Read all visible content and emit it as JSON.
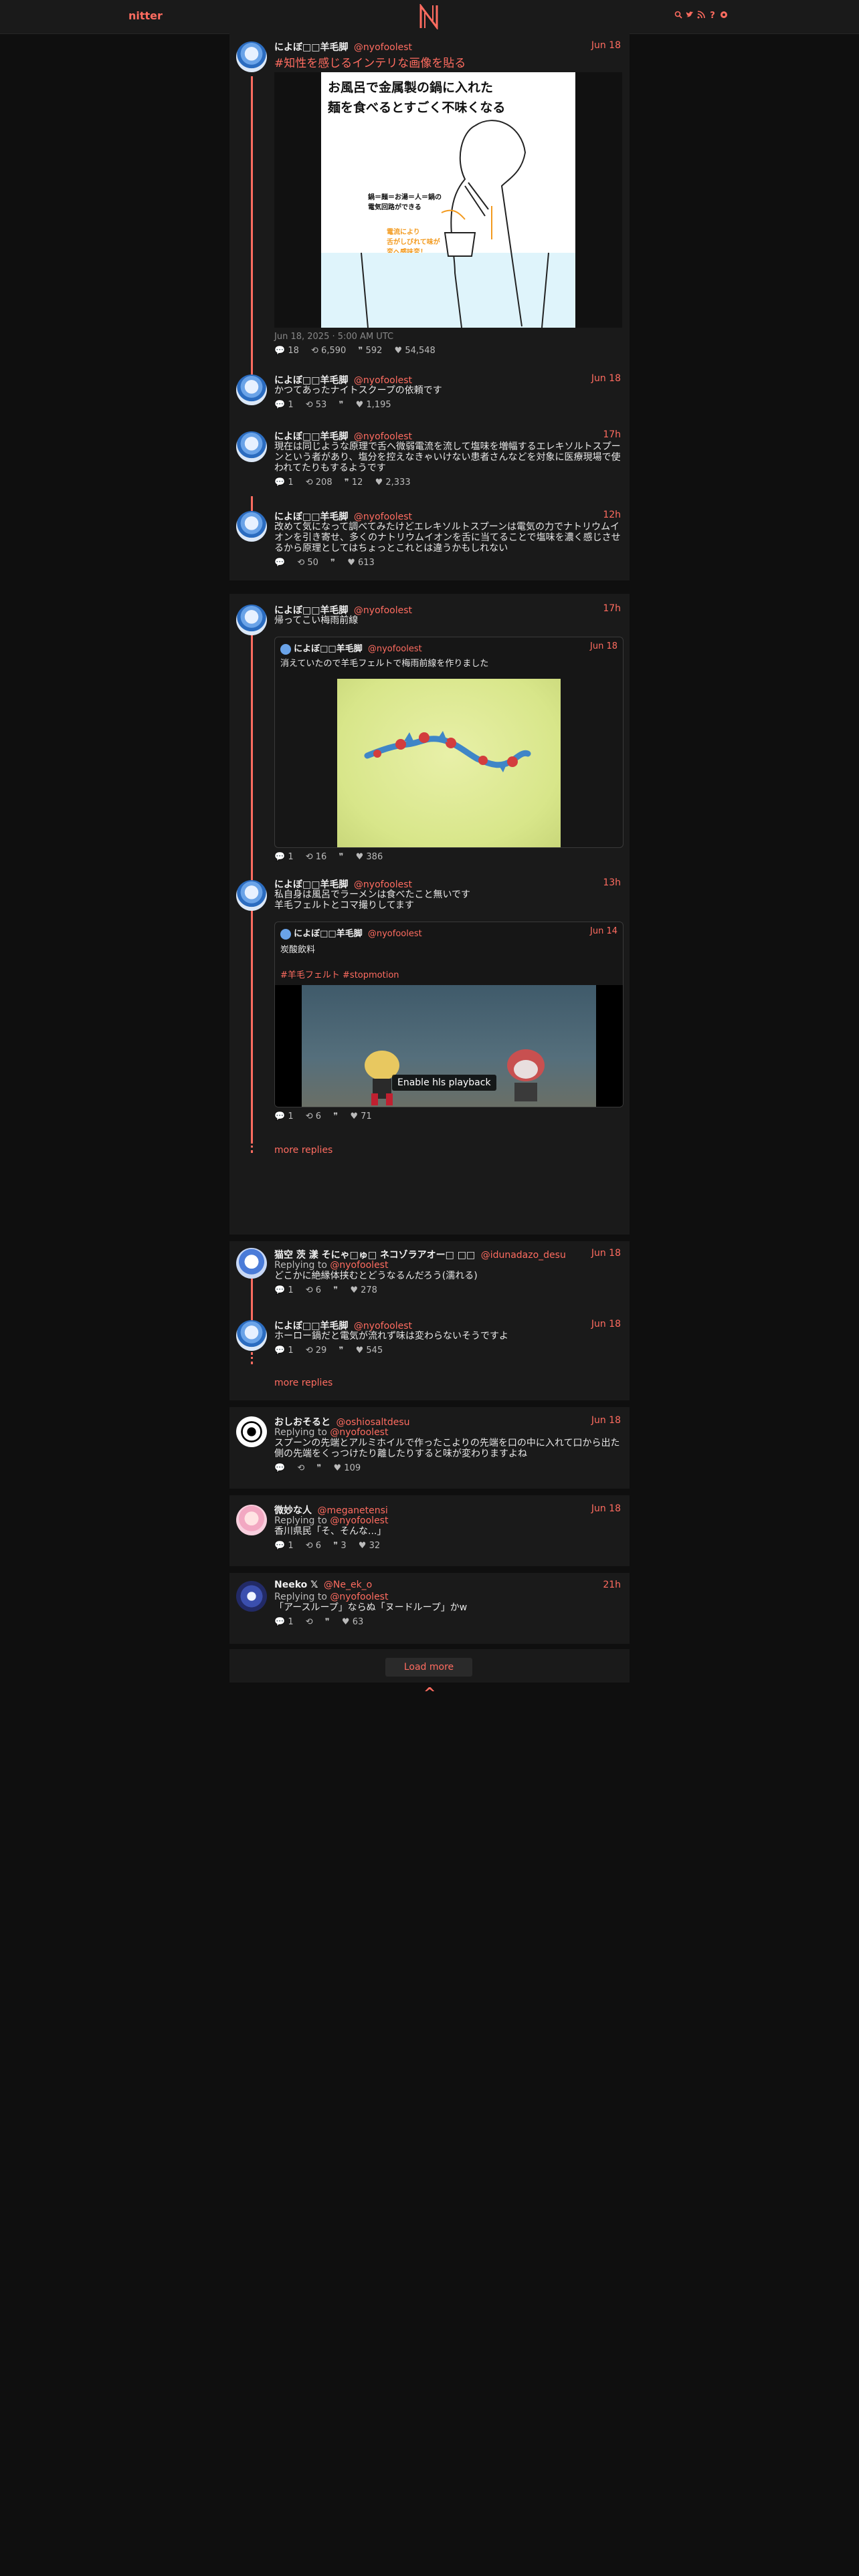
{
  "nav": {
    "brand": "nitter",
    "logo": "N",
    "icons": [
      "search-icon",
      "twitter-bird-icon",
      "rss-icon",
      "help-icon",
      "settings-icon"
    ],
    "icon_glyphs": [
      "🔍",
      "🐦",
      "📡",
      "?",
      "⚙"
    ]
  },
  "thread1": {
    "main": {
      "fullname": "によぼ□□羊毛脚",
      "username": "@nyofoolest",
      "date": "Jun 18",
      "title_link": "#知性を感じるインテリな画像を貼る",
      "image_text_line1": "お風呂で金属製の鍋に入れた",
      "image_text_line2": "麺を食べるとすごく不味くなる",
      "image_caption": "鍋＝麺＝お湯＝人＝鍋の\n電気回路ができる",
      "image_caption_orange": "電流により\n舌がしびれて味が\n変へ感味変！",
      "timestamp": "Jun 18, 2025 · 5:00 AM UTC",
      "replies": "18",
      "retweets": "6,590",
      "quotes": "592",
      "likes": "54,548"
    },
    "replies": [
      {
        "fullname": "によぼ□□羊毛脚",
        "username": "@nyofoolest",
        "date": "Jun 18",
        "text": "かつてあったナイトスクープの依頼です",
        "replies": "1",
        "retweets": "53",
        "quotes": "",
        "likes": "1,195"
      },
      {
        "fullname": "によぼ□□羊毛脚",
        "username": "@nyofoolest",
        "date": "17h",
        "text": "現在は同じような原理で舌へ微弱電流を流して塩味を増幅するエレキソルトスプーンという者があり、塩分を控えなきゃいけない患者さんなどを対象に医療現場で使われてたりもするようです",
        "replies": "1",
        "retweets": "208",
        "quotes": "12",
        "likes": "2,333"
      },
      {
        "fullname": "によぼ□□羊毛脚",
        "username": "@nyofoolest",
        "date": "12h",
        "text": "改めて気になって調べてみたけどエレキソルトスプーンは電気の力でナトリウムイオンを引き寄せ、多くのナトリウムイオンを舌に当てることで塩味を濃く感じさせるから原理としてはちょっとこれとは違うかもしれない",
        "replies": "",
        "retweets": "50",
        "quotes": "",
        "likes": "613"
      }
    ]
  },
  "thread2": {
    "main": {
      "fullname": "によぼ□□羊毛脚",
      "username": "@nyofoolest",
      "date": "17h",
      "text": "帰ってこい梅雨前線",
      "quote": {
        "fullname": "によぼ□□羊毛脚",
        "username": "@nyofoolest",
        "date": "Jun 18",
        "text": "消えていたので羊毛フェルトで梅雨前線を作りました"
      },
      "replies": "1",
      "retweets": "16",
      "quotes": "",
      "likes": "386"
    },
    "reply": {
      "fullname": "によぼ□□羊毛脚",
      "username": "@nyofoolest",
      "date": "13h",
      "text": "私自身は風呂でラーメンは食べたこと無いです\n羊毛フェルトとコマ撮りしてます",
      "quote": {
        "fullname": "によぼ□□羊毛脚",
        "username": "@nyofoolest",
        "date": "Jun 14",
        "text": "炭酸飲料",
        "hashtags": "#羊毛フェルト #stopmotion",
        "overlay": "Enable hls playback"
      },
      "replies": "1",
      "retweets": "6",
      "quotes": "",
      "likes": "71"
    },
    "more_replies": "more replies"
  },
  "thread3": {
    "first": {
      "fullname": "猫空 茨 漾 そにゃ□ゅ□ ネコゾラアオー□ □□",
      "username": "@idunadazo_desu",
      "date": "Jun 18",
      "replying_label": "Replying to",
      "replying_to": "@nyofoolest",
      "text": "どこかに絶縁体挟むとどうなるんだろう(濡れる)",
      "replies": "1",
      "retweets": "6",
      "quotes": "",
      "likes": "278"
    },
    "second": {
      "fullname": "によぼ□□羊毛脚",
      "username": "@nyofoolest",
      "date": "Jun 18",
      "text": "ホーロー鍋だと電気が流れず味は変わらないそうですよ",
      "replies": "1",
      "retweets": "29",
      "quotes": "",
      "likes": "545"
    },
    "more_replies": "more replies"
  },
  "single_replies": [
    {
      "fullname": "おしおそると",
      "username": "@oshiosaltdesu",
      "date": "Jun 18",
      "replying_label": "Replying to",
      "replying_to": "@nyofoolest",
      "text": "スプーンの先端とアルミホイルで作ったこよりの先端を口の中に入れて口から出た側の先端をくっつけたり離したりすると味が変わりますよね",
      "replies": "",
      "retweets": "",
      "quotes": "",
      "likes": "109"
    },
    {
      "fullname": "微妙な人",
      "username": "@meganetensi",
      "date": "Jun 18",
      "replying_label": "Replying to",
      "replying_to": "@nyofoolest",
      "text": "香川県民「そ、そんな...」",
      "replies": "1",
      "retweets": "6",
      "quotes": "3",
      "likes": "32"
    },
    {
      "fullname": "Neeko 𝕏",
      "username": "@Ne_ek_o",
      "date": "21h",
      "replying_label": "Replying to",
      "replying_to": "@nyofoolest",
      "text": "「アースループ」ならぬ「ヌードループ」かw",
      "replies": "1",
      "retweets": "",
      "quotes": "",
      "likes": "63"
    }
  ],
  "footer": {
    "load_more": "Load more",
    "up_arrow": "^"
  },
  "colors": {
    "accent": "#ff6c60",
    "bg": "#0f0f0f",
    "panel": "#1a1a1a"
  }
}
